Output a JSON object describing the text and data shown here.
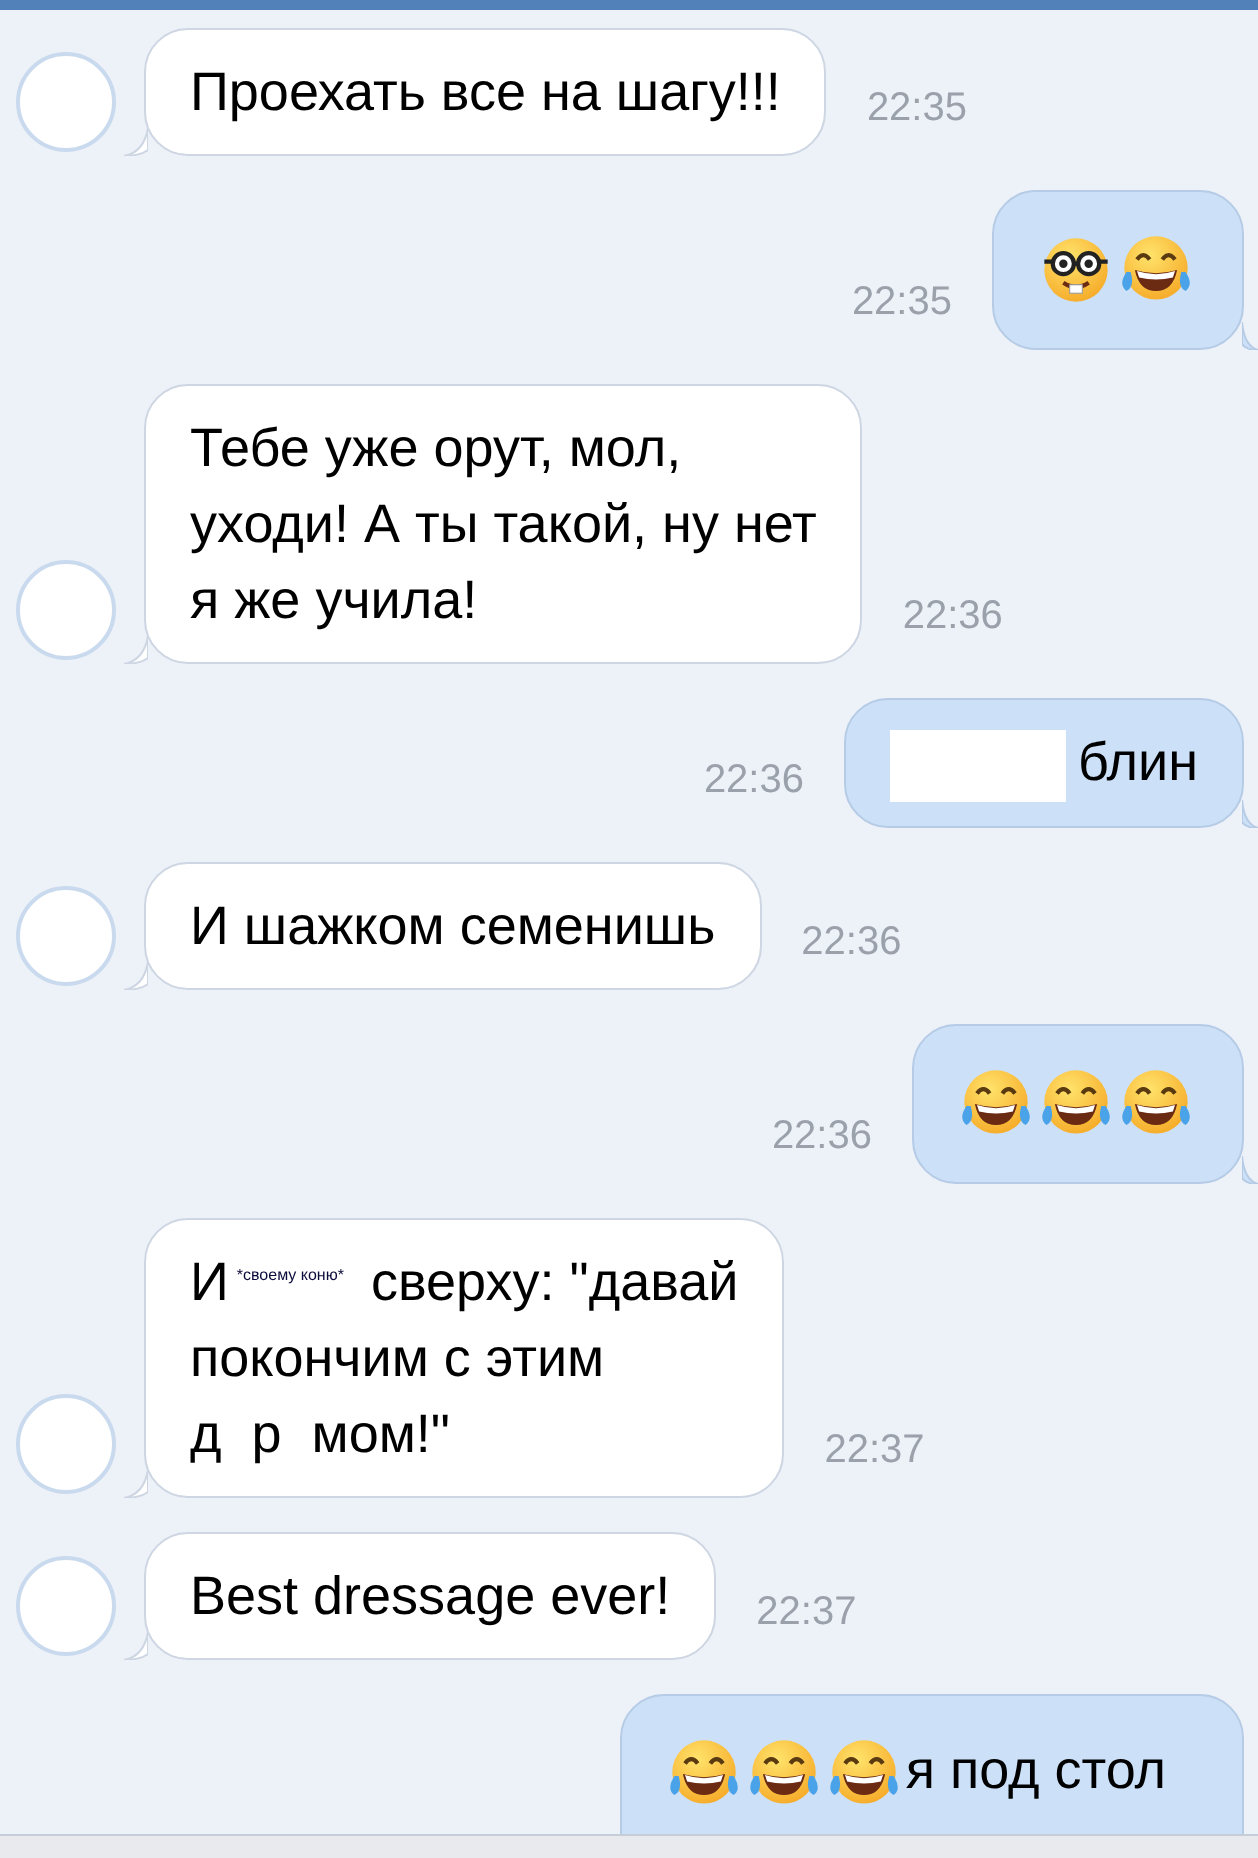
{
  "messages": [
    {
      "kind": "incoming",
      "time": "22:35",
      "parts": [
        {
          "kind": "text",
          "text": "Проехать все на шагу!!!"
        }
      ]
    },
    {
      "kind": "outgoing",
      "time": "22:35",
      "parts": [
        {
          "kind": "nerd-emoji"
        },
        {
          "kind": "laugh-emoji"
        }
      ]
    },
    {
      "kind": "incoming",
      "time": "22:36",
      "parts": [
        {
          "kind": "text",
          "text": "Тебе уже орут, мол,\nуходи! А ты такой, ну нет\nя же учила!"
        }
      ]
    },
    {
      "kind": "outgoing",
      "time": "22:36",
      "parts": [
        {
          "kind": "redacted"
        },
        {
          "kind": "text",
          "text": "блин"
        }
      ]
    },
    {
      "kind": "incoming",
      "time": "22:36",
      "parts": [
        {
          "kind": "text",
          "text": "И шажком семенишь"
        }
      ]
    },
    {
      "kind": "outgoing",
      "time": "22:36",
      "parts": [
        {
          "kind": "laugh-emoji"
        },
        {
          "kind": "laugh-emoji"
        },
        {
          "kind": "laugh-emoji"
        }
      ]
    },
    {
      "kind": "incoming",
      "time": "22:37",
      "parts": [
        {
          "kind": "text",
          "text": "И"
        },
        {
          "kind": "small",
          "text": "*своему коню*"
        },
        {
          "kind": "text",
          "text": " сверху: \"давай"
        },
        {
          "kind": "line",
          "text": "покончим с этим"
        },
        {
          "kind": "line",
          "text": "д  р  мом!\""
        }
      ]
    },
    {
      "kind": "incoming",
      "time": "22:37",
      "parts": [
        {
          "kind": "text",
          "text": "Best dressage ever!"
        }
      ]
    },
    {
      "kind": "outgoing",
      "parts": [
        {
          "kind": "laugh-emoji"
        },
        {
          "kind": "laugh-emoji"
        },
        {
          "kind": "laugh-emoji"
        },
        {
          "kind": "text",
          "text": "я под стол"
        }
      ]
    }
  ]
}
